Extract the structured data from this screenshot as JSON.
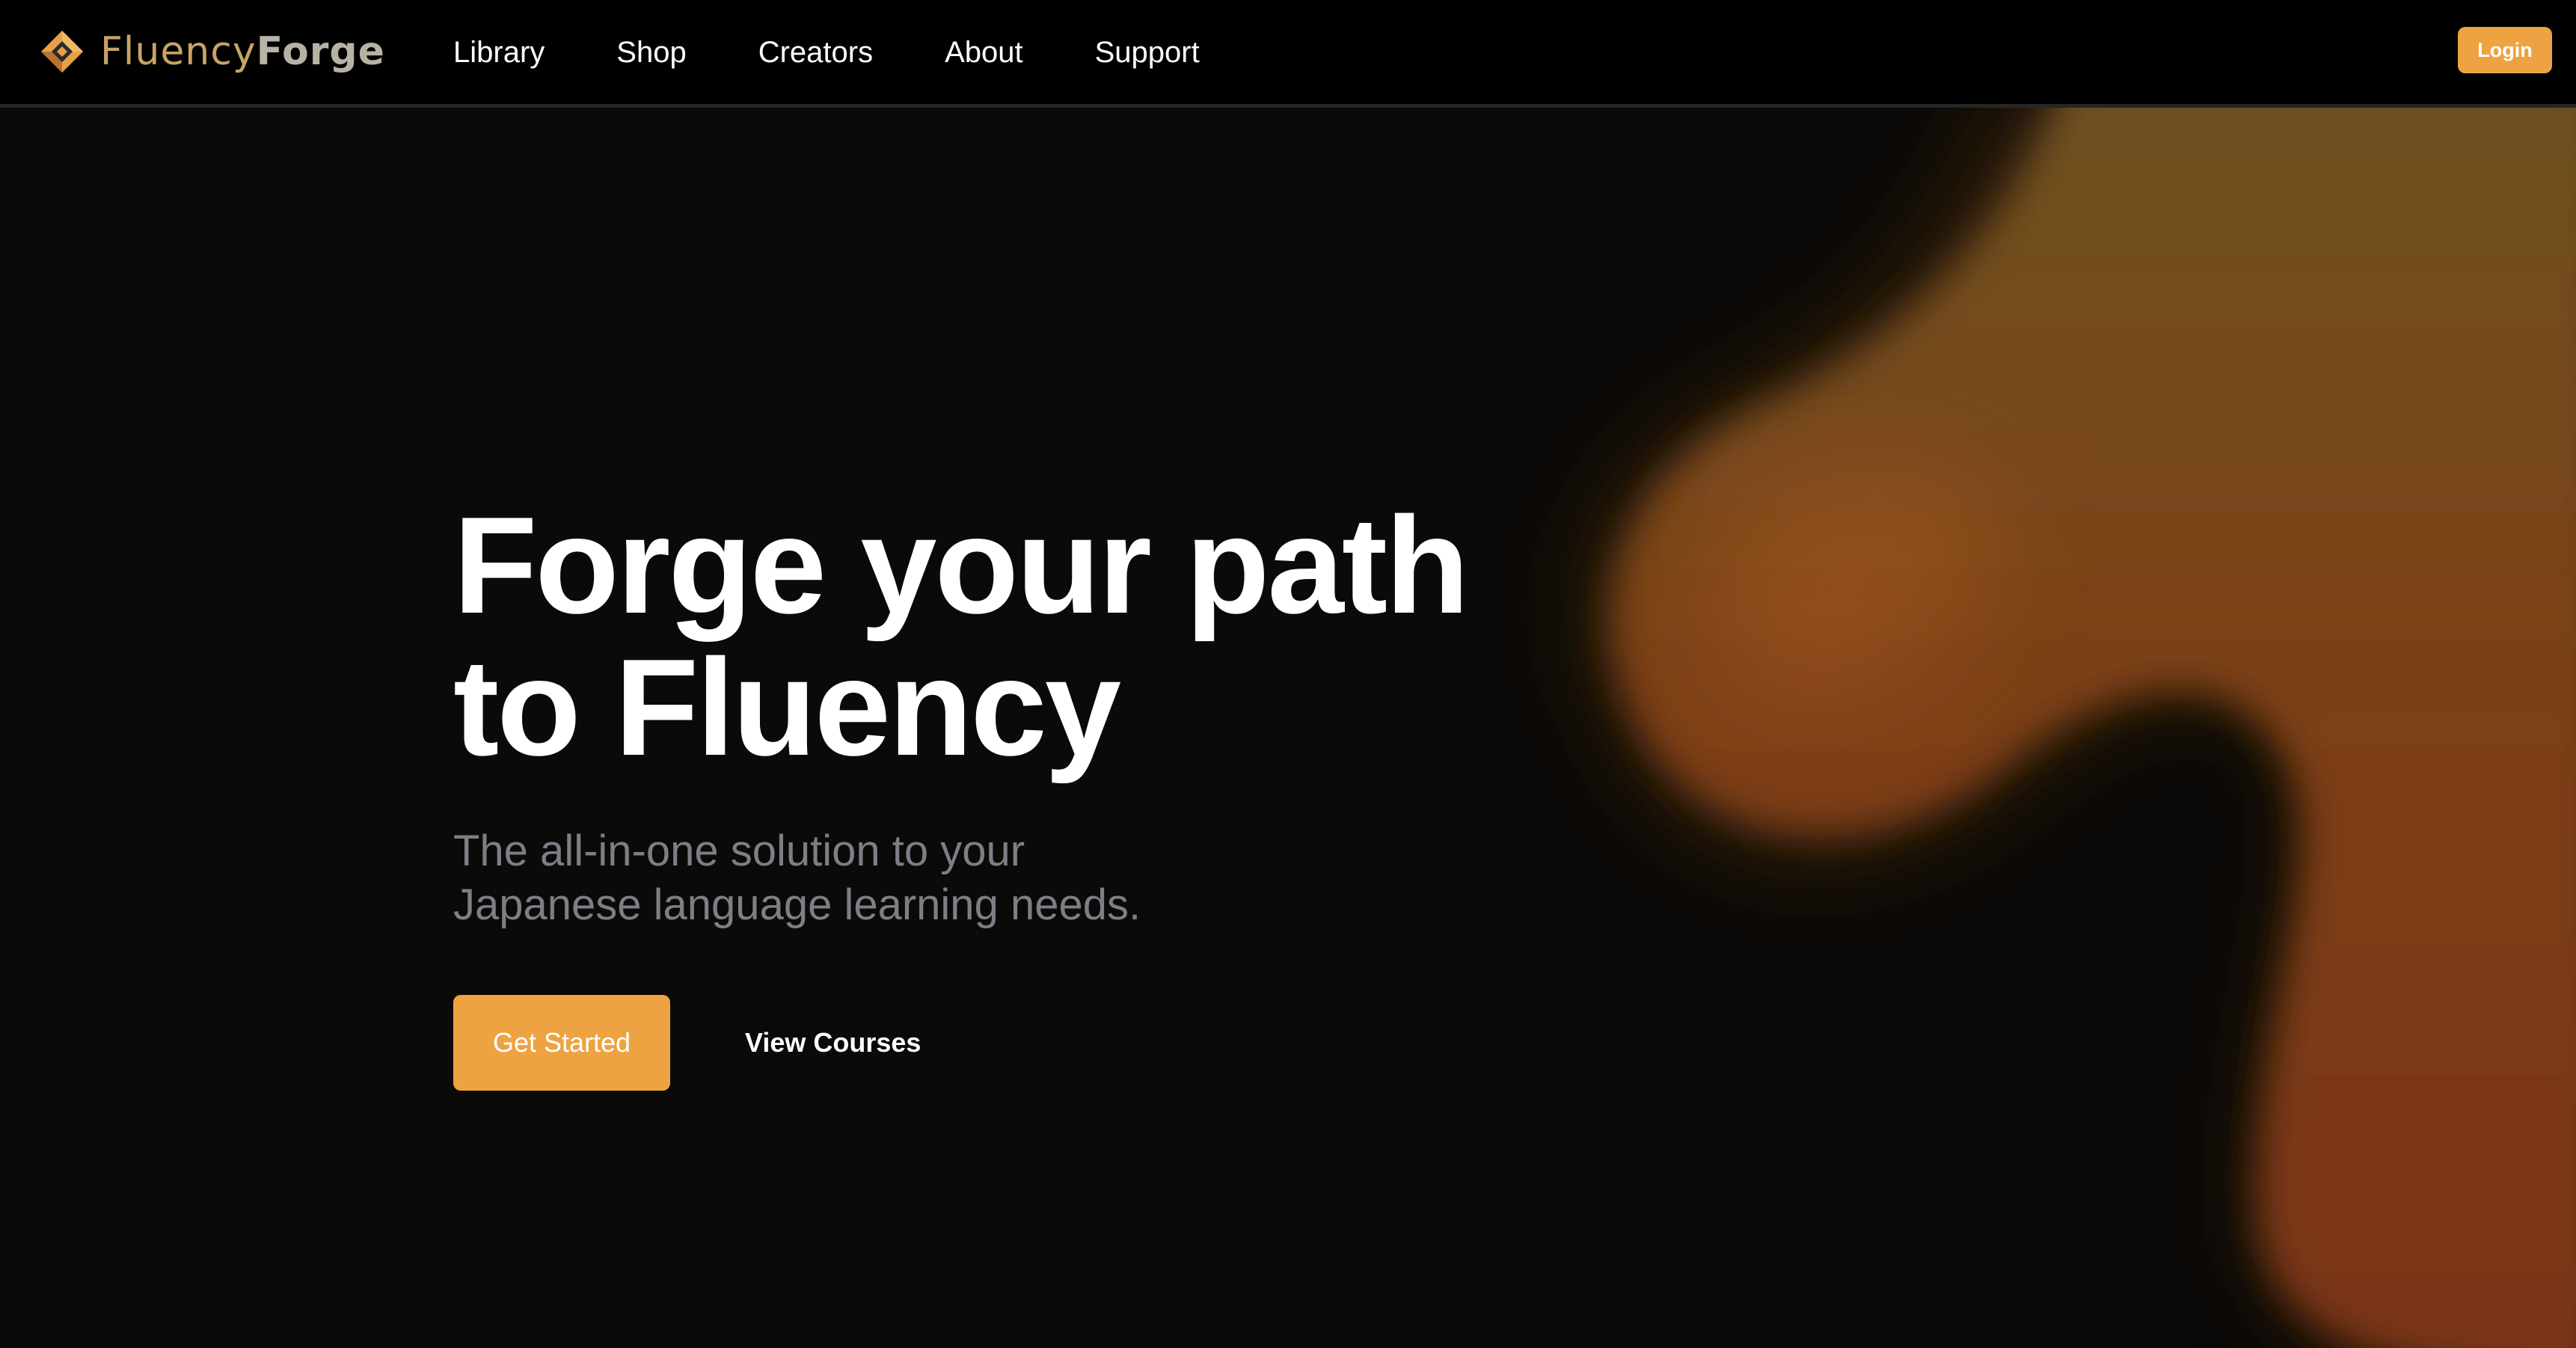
{
  "brand": {
    "name_part1": "Fluency",
    "name_part2": "Forge",
    "accent_color": "#eea343"
  },
  "nav": {
    "links": [
      "Library",
      "Shop",
      "Creators",
      "About",
      "Support"
    ],
    "login_label": "Login"
  },
  "hero": {
    "title_line1": "Forge your path",
    "title_line2": "to Fluency",
    "subtitle_line1": "The all-in-one solution to your",
    "subtitle_line2": "Japanese language learning needs.",
    "primary_cta": "Get Started",
    "secondary_cta": "View Courses"
  },
  "icons": {
    "logo": "diamond-logo-icon"
  }
}
